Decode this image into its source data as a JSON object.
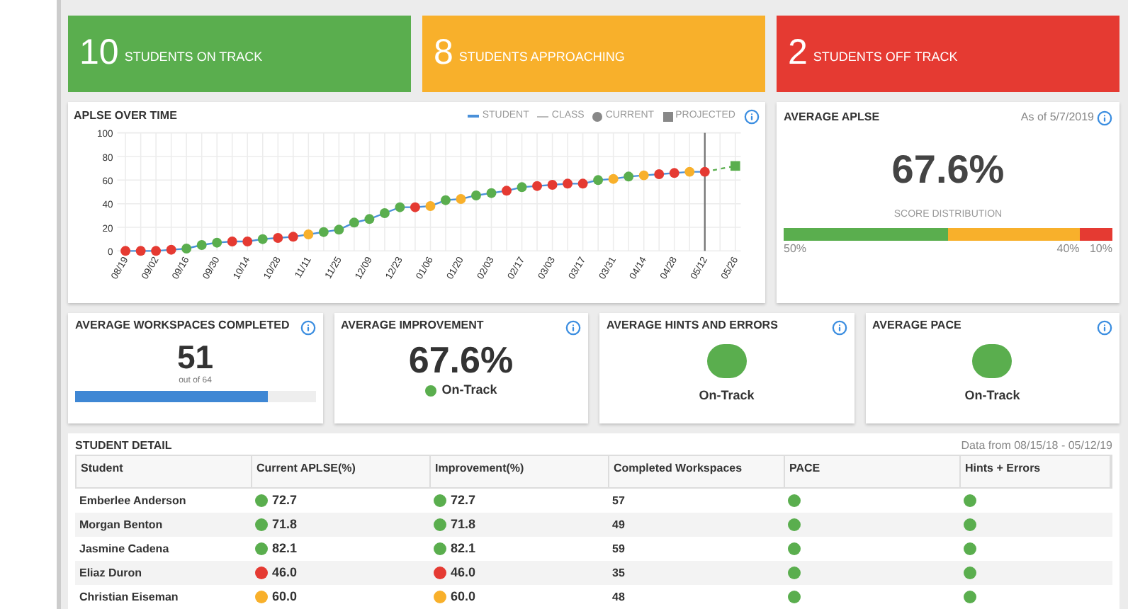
{
  "summary_cards": [
    {
      "count": "10",
      "label": "STUDENTS ON TRACK",
      "color": "#5aae4e"
    },
    {
      "count": "8",
      "label": "STUDENTS APPROACHING",
      "color": "#f8b02b"
    },
    {
      "count": "2",
      "label": "STUDENTS OFF TRACK",
      "color": "#e53a32"
    }
  ],
  "chart_panel": {
    "title": "APLSE OVER TIME",
    "legend": [
      {
        "label": "STUDENT",
        "kind": "line"
      },
      {
        "label": "CLASS",
        "kind": "thin"
      },
      {
        "label": "CURRENT",
        "kind": "dot"
      },
      {
        "label": "PROJECTED",
        "kind": "square"
      }
    ],
    "chart_data": {
      "type": "line",
      "grid": true,
      "ylim": [
        0,
        100
      ],
      "yticks": [
        0,
        20,
        40,
        60,
        80,
        100
      ],
      "categories": [
        "08/19",
        null,
        "09/02",
        null,
        "09/16",
        null,
        "09/30",
        null,
        "10/14",
        null,
        "10/28",
        null,
        "11/11",
        null,
        "11/25",
        null,
        "12/09",
        null,
        "12/23",
        null,
        "01/06",
        null,
        "01/20",
        null,
        "02/03",
        null,
        "02/17",
        null,
        "03/03",
        null,
        "03/17",
        null,
        "03/31",
        null,
        "04/14",
        null,
        "04/28",
        null,
        "05/12",
        null,
        "05/26"
      ],
      "ref_lines": [
        {
          "axis": "x",
          "value": "05/12",
          "color": "#777777"
        }
      ],
      "series": [
        {
          "color": "#4a90d9",
          "line_style": "solid",
          "marker": "circle",
          "values": [
            0,
            0,
            0,
            1,
            2,
            5,
            7,
            8,
            8,
            10,
            11,
            12,
            14,
            16,
            18,
            24,
            27,
            32,
            37,
            37,
            38,
            43,
            44,
            47,
            49,
            51,
            54,
            55,
            56,
            57,
            57,
            60,
            61,
            63,
            64,
            65,
            66,
            67,
            67,
            null,
            null
          ]
        },
        {
          "color": "#5aae4e",
          "line_style": "dashed",
          "marker": "square",
          "values": [
            null,
            null,
            null,
            null,
            null,
            null,
            null,
            null,
            null,
            null,
            null,
            null,
            null,
            null,
            null,
            null,
            null,
            null,
            null,
            null,
            null,
            null,
            null,
            null,
            null,
            null,
            null,
            null,
            null,
            null,
            null,
            null,
            null,
            null,
            null,
            null,
            null,
            null,
            67,
            null,
            72
          ]
        }
      ]
    },
    "points": [
      {
        "color": "#e53a32"
      },
      {
        "color": "#e53a32"
      },
      {
        "color": "#e53a32"
      },
      {
        "color": "#e53a32"
      },
      {
        "color": "#5aae4e"
      },
      {
        "color": "#5aae4e"
      },
      {
        "color": "#5aae4e"
      },
      {
        "color": "#e53a32"
      },
      {
        "color": "#e53a32"
      },
      {
        "color": "#5aae4e"
      },
      {
        "color": "#e53a32"
      },
      {
        "color": "#e53a32"
      },
      {
        "color": "#f8b02b"
      },
      {
        "color": "#5aae4e"
      },
      {
        "color": "#5aae4e"
      },
      {
        "color": "#5aae4e"
      },
      {
        "color": "#5aae4e"
      },
      {
        "color": "#5aae4e"
      },
      {
        "color": "#5aae4e"
      },
      {
        "color": "#e53a32"
      },
      {
        "color": "#f8b02b"
      },
      {
        "color": "#5aae4e"
      },
      {
        "color": "#f8b02b"
      },
      {
        "color": "#5aae4e"
      },
      {
        "color": "#5aae4e"
      },
      {
        "color": "#e53a32"
      },
      {
        "color": "#5aae4e"
      },
      {
        "color": "#e53a32"
      },
      {
        "color": "#e53a32"
      },
      {
        "color": "#e53a32"
      },
      {
        "color": "#e53a32"
      },
      {
        "color": "#5aae4e"
      },
      {
        "color": "#f8b02b"
      },
      {
        "color": "#5aae4e"
      },
      {
        "color": "#f8b02b"
      },
      {
        "color": "#e53a32"
      },
      {
        "color": "#e53a32"
      },
      {
        "color": "#f8b02b"
      },
      {
        "color": "#e53a32"
      }
    ]
  },
  "average_aplse": {
    "title": "AVERAGE APLSE",
    "as_of": "As of 5/7/2019",
    "value": "67.6%",
    "distribution_label": "SCORE DISTRIBUTION",
    "segments": [
      {
        "color": "#5aae4e",
        "label": "50%"
      },
      {
        "color": "#f8b02b",
        "label": "40%"
      },
      {
        "color": "#e53a32",
        "label": "10%"
      }
    ]
  },
  "metric_cards": [
    {
      "kind": "progress",
      "title": "AVERAGE WORKSPACES COMPLETED",
      "value": "51",
      "caption": "out of 64",
      "level": 0.8
    },
    {
      "kind": "value_status",
      "title": "AVERAGE IMPROVEMENT",
      "value": "67.6%",
      "status": "On-Track",
      "color": "#5aae4e"
    },
    {
      "kind": "dot_status",
      "title": "AVERAGE HINTS AND ERRORS",
      "status": "On-Track",
      "color": "#5aae4e"
    },
    {
      "kind": "dot_status",
      "title": "AVERAGE PACE",
      "status": "On-Track",
      "color": "#5aae4e"
    }
  ],
  "student_detail": {
    "title": "STUDENT DETAIL",
    "date_range": "Data from 08/15/18 - 05/12/19",
    "columns": [
      "Student",
      "Current APLSE(%)",
      "Improvement(%)",
      "Completed Workspaces",
      "PACE",
      "Hints + Errors"
    ],
    "rows": [
      {
        "student": "Emberlee Anderson",
        "current": {
          "value": "72.7",
          "color": "#5aae4e"
        },
        "improvement": {
          "value": "72.7",
          "color": "#5aae4e"
        },
        "completed": "57",
        "pace": {
          "color": "#5aae4e"
        },
        "hints": {
          "color": "#5aae4e"
        }
      },
      {
        "student": "Morgan Benton",
        "current": {
          "value": "71.8",
          "color": "#5aae4e"
        },
        "improvement": {
          "value": "71.8",
          "color": "#5aae4e"
        },
        "completed": "49",
        "pace": {
          "color": "#5aae4e"
        },
        "hints": {
          "color": "#5aae4e"
        }
      },
      {
        "student": "Jasmine Cadena",
        "current": {
          "value": "82.1",
          "color": "#5aae4e"
        },
        "improvement": {
          "value": "82.1",
          "color": "#5aae4e"
        },
        "completed": "59",
        "pace": {
          "color": "#5aae4e"
        },
        "hints": {
          "color": "#5aae4e"
        }
      },
      {
        "student": "Eliaz Duron",
        "current": {
          "value": "46.0",
          "color": "#e53a32"
        },
        "improvement": {
          "value": "46.0",
          "color": "#e53a32"
        },
        "completed": "35",
        "pace": {
          "color": "#5aae4e"
        },
        "hints": {
          "color": "#5aae4e"
        }
      },
      {
        "student": "Christian Eiseman",
        "current": {
          "value": "60.0",
          "color": "#f8b02b"
        },
        "improvement": {
          "value": "60.0",
          "color": "#f8b02b"
        },
        "completed": "48",
        "pace": {
          "color": "#5aae4e"
        },
        "hints": {
          "color": "#5aae4e"
        }
      }
    ]
  }
}
